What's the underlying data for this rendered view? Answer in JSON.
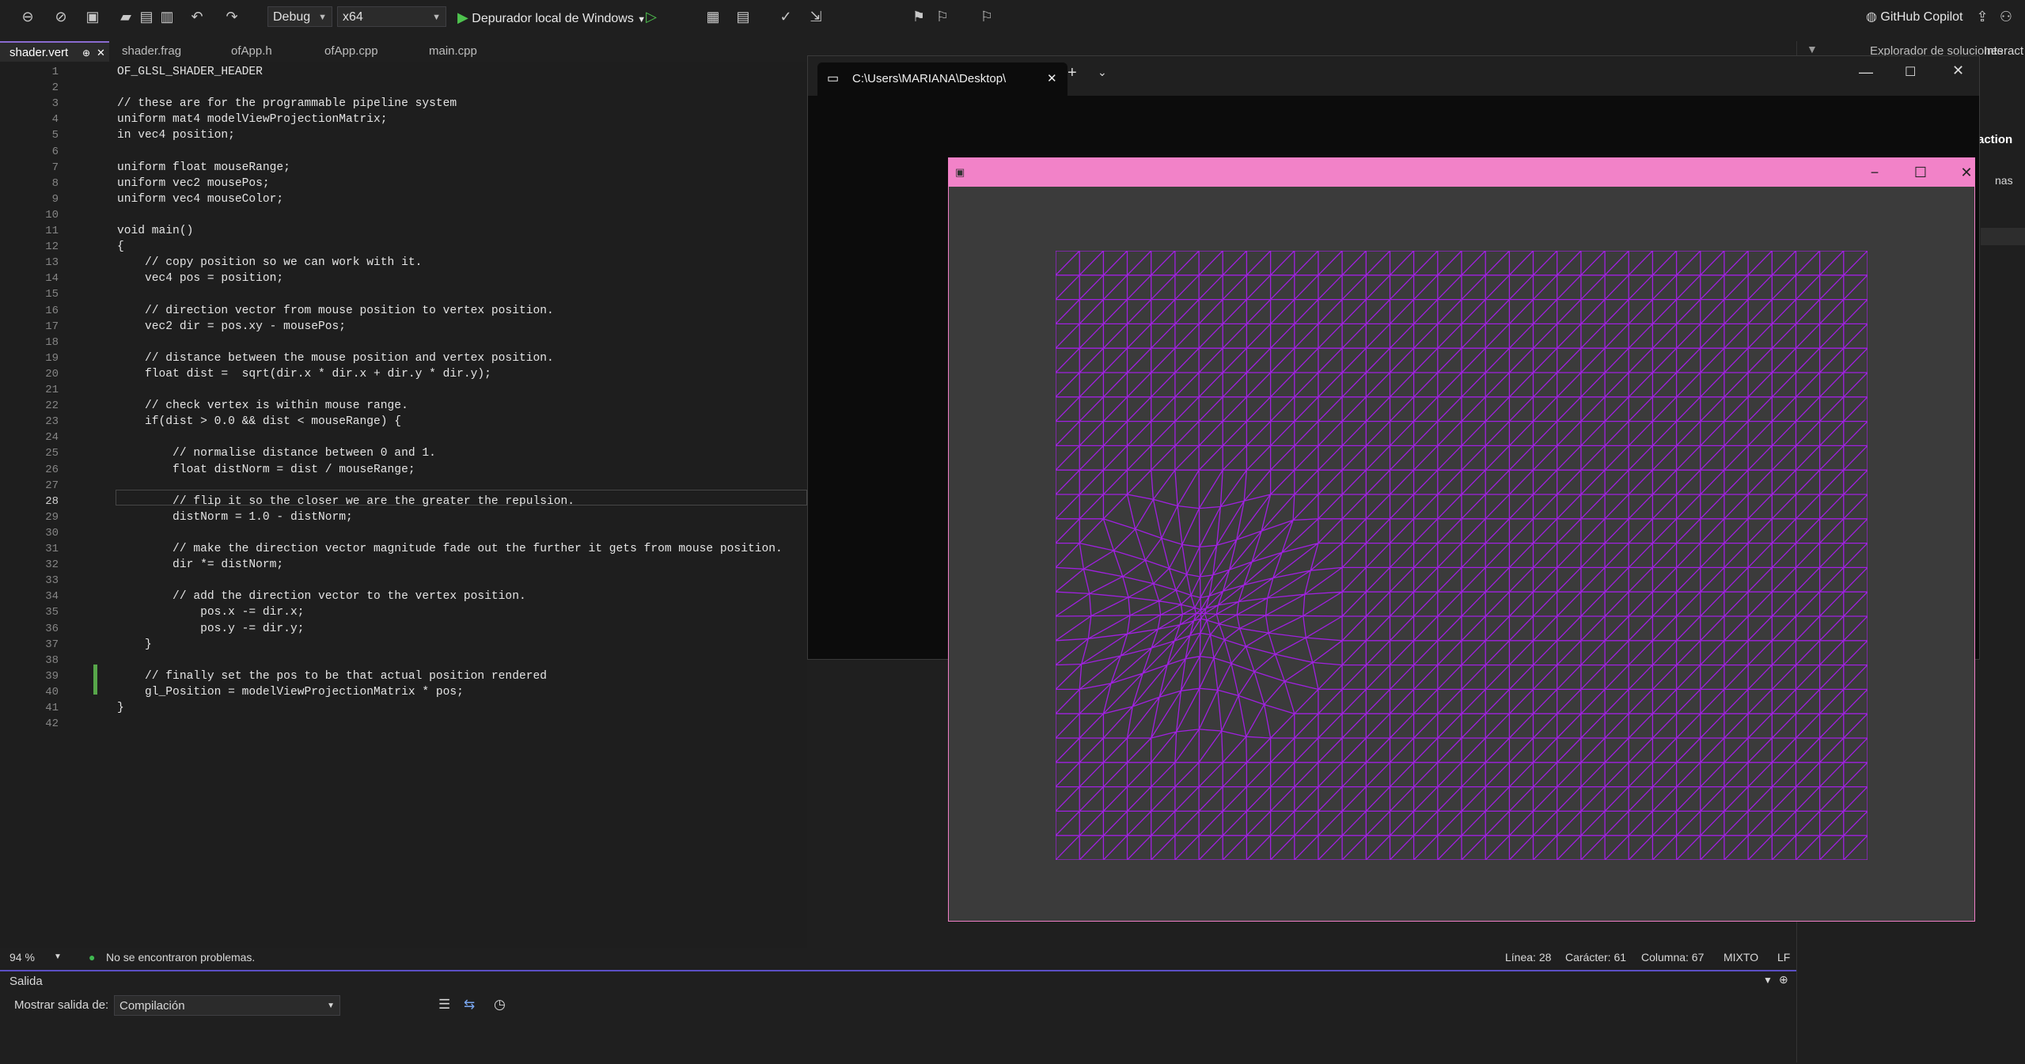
{
  "toolbar": {
    "config": "Debug",
    "platform": "x64",
    "debugger": "Depurador local de Windows",
    "copilot": "GitHub Copilot"
  },
  "tabs": [
    {
      "label": "shader.vert",
      "active": true
    },
    {
      "label": "shader.frag",
      "active": false
    },
    {
      "label": "ofApp.h",
      "active": false
    },
    {
      "label": "ofApp.cpp",
      "active": false
    },
    {
      "label": "main.cpp",
      "active": false
    }
  ],
  "editor": {
    "current_line": 28,
    "lines": [
      "OF_GLSL_SHADER_HEADER",
      "",
      "// these are for the programmable pipeline system",
      "uniform mat4 modelViewProjectionMatrix;",
      "in vec4 position;",
      "",
      "uniform float mouseRange;",
      "uniform vec2 mousePos;",
      "uniform vec4 mouseColor;",
      "",
      "void main()",
      "{",
      "    // copy position so we can work with it.",
      "    vec4 pos = position;",
      "",
      "    // direction vector from mouse position to vertex position.",
      "    vec2 dir = pos.xy - mousePos;",
      "",
      "    // distance between the mouse position and vertex position.",
      "    float dist =  sqrt(dir.x * dir.x + dir.y * dir.y);",
      "",
      "    // check vertex is within mouse range.",
      "    if(dist > 0.0 && dist < mouseRange) {",
      "",
      "        // normalise distance between 0 and 1.",
      "        float distNorm = dist / mouseRange;",
      "",
      "        // flip it so the closer we are the greater the repulsion.",
      "        distNorm = 1.0 - distNorm;",
      "",
      "        // make the direction vector magnitude fade out the further it gets from mouse position.",
      "        dir *= distNorm;",
      "",
      "        // add the direction vector to the vertex position.",
      "            pos.x -= dir.x;",
      "            pos.y -= dir.y;",
      "    }",
      "",
      "    // finally set the pos to be that actual position rendered",
      "    gl_Position = modelViewProjectionMatrix * pos;",
      "}",
      ""
    ]
  },
  "status": {
    "zoom": "94 %",
    "problems": "No se encontraron problemas.",
    "line": "Línea: 28",
    "char": "Carácter: 61",
    "col": "Columna: 67",
    "encoding": "MIXTO",
    "eol": "LF"
  },
  "output": {
    "title": "Salida",
    "show_label": "Mostrar salida de:",
    "source": "Compilación"
  },
  "solution": {
    "title": "Explorador de soluciones",
    "frag1": "Interact",
    "frag2": "action",
    "frag3": "nas"
  },
  "terminal": {
    "tab_title": "C:\\Users\\MARIANA\\Desktop\\"
  },
  "colors": {
    "accent": "#8a6bd1",
    "app_titlebar": "#f282c8",
    "mesh": "#a020e0"
  }
}
